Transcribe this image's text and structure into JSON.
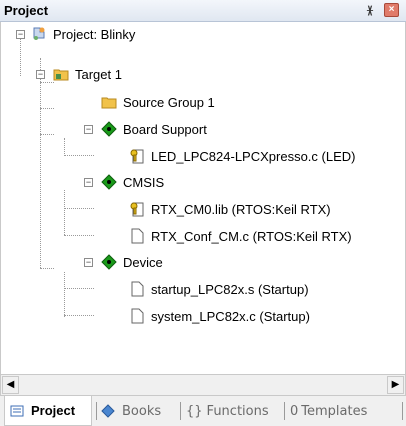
{
  "panel": {
    "title": "Project",
    "pin_glyph": "ᚕ",
    "close_glyph": "×"
  },
  "tree": {
    "root": "Project: Blinky",
    "target": "Target 1",
    "source_group": "Source Group 1",
    "board_support": "Board Support",
    "led_file": "LED_LPC824-LPCXpresso.c (LED)",
    "cmsis": "CMSIS",
    "rtx_lib": "RTX_CM0.lib (RTOS:Keil RTX)",
    "rtx_conf": "RTX_Conf_CM.c (RTOS:Keil RTX)",
    "device": "Device",
    "startup": "startup_LPC82x.s (Startup)",
    "system": "system_LPC82x.c (Startup)"
  },
  "expander_glyphs": {
    "collapse": "−"
  },
  "scrollbar": {
    "left": "◀",
    "right": "▶"
  },
  "tabs": {
    "project": "Project",
    "books": "Books",
    "functions": "Functions",
    "functions_icon": "{}",
    "templates": "Templates",
    "templates_icon": "0"
  },
  "icons": [
    "project-icon",
    "folder-icon",
    "key-icon",
    "file-icon",
    "component-icon"
  ],
  "colors": {
    "component_green": "#1a9a1a",
    "folder_yellow": "#f1c24a",
    "close_red": "#e07b6a"
  }
}
